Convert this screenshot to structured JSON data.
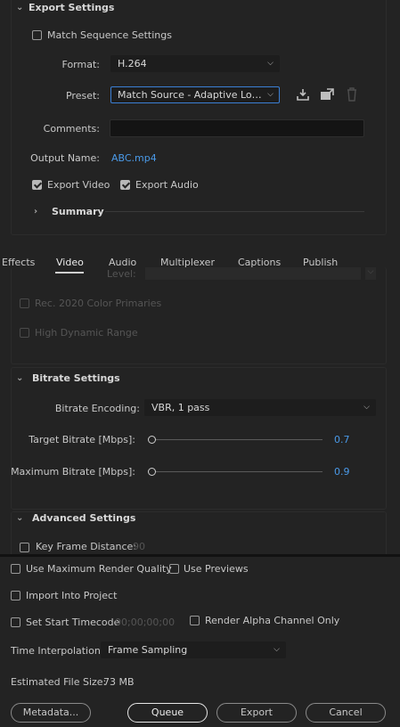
{
  "export_settings": {
    "title": "Export Settings",
    "match_sequence": {
      "label": "Match Sequence Settings",
      "checked": false
    },
    "format": {
      "label": "Format:",
      "value": "H.264"
    },
    "preset": {
      "label": "Preset:",
      "value": "Match Source - Adaptive Low Bi..."
    },
    "comments": {
      "label": "Comments:",
      "value": ""
    },
    "output_name": {
      "label": "Output Name:",
      "value": "ABC.mp4"
    },
    "export_video": {
      "label": "Export Video",
      "checked": true
    },
    "export_audio": {
      "label": "Export Audio",
      "checked": true
    },
    "summary": {
      "label": "Summary"
    }
  },
  "tabs": [
    {
      "label": "Effects",
      "active": false
    },
    {
      "label": "Video",
      "active": true
    },
    {
      "label": "Audio",
      "active": false
    },
    {
      "label": "Multiplexer",
      "active": false
    },
    {
      "label": "Captions",
      "active": false
    },
    {
      "label": "Publish",
      "active": false
    }
  ],
  "video": {
    "level_label": "Level:",
    "rec2020": {
      "label": "Rec. 2020 Color Primaries",
      "checked": false
    },
    "hdr": {
      "label": "High Dynamic Range",
      "checked": false
    }
  },
  "bitrate": {
    "title": "Bitrate Settings",
    "encoding": {
      "label": "Bitrate Encoding:",
      "value": "VBR, 1 pass"
    },
    "target": {
      "label": "Target Bitrate [Mbps]:",
      "value": "0.7",
      "fraction": 0.0
    },
    "maximum": {
      "label": "Maximum Bitrate [Mbps]:",
      "value": "0.9",
      "fraction": 0.0
    }
  },
  "advanced": {
    "title": "Advanced Settings",
    "key_frame": {
      "label": "Key Frame Distance:",
      "value": "90",
      "checked": false
    }
  },
  "footer": {
    "max_render": {
      "label": "Use Maximum Render Quality",
      "checked": false
    },
    "use_previews": {
      "label": "Use Previews",
      "checked": false
    },
    "import_project": {
      "label": "Import Into Project",
      "checked": false
    },
    "start_timecode": {
      "label": "Set Start Timecode",
      "value": "00;00;00;00",
      "checked": false
    },
    "alpha_only": {
      "label": "Render Alpha Channel Only",
      "checked": false
    },
    "time_interp": {
      "label": "Time Interpolation:",
      "value": "Frame Sampling"
    },
    "file_size": {
      "label": "Estimated File Size:",
      "value": "73 MB"
    },
    "buttons": {
      "metadata": "Metadata...",
      "queue": "Queue",
      "export": "Export",
      "cancel": "Cancel"
    }
  },
  "colors": {
    "accent": "#4a9ae8",
    "background": "#232323",
    "field": "#1d1d1d"
  }
}
